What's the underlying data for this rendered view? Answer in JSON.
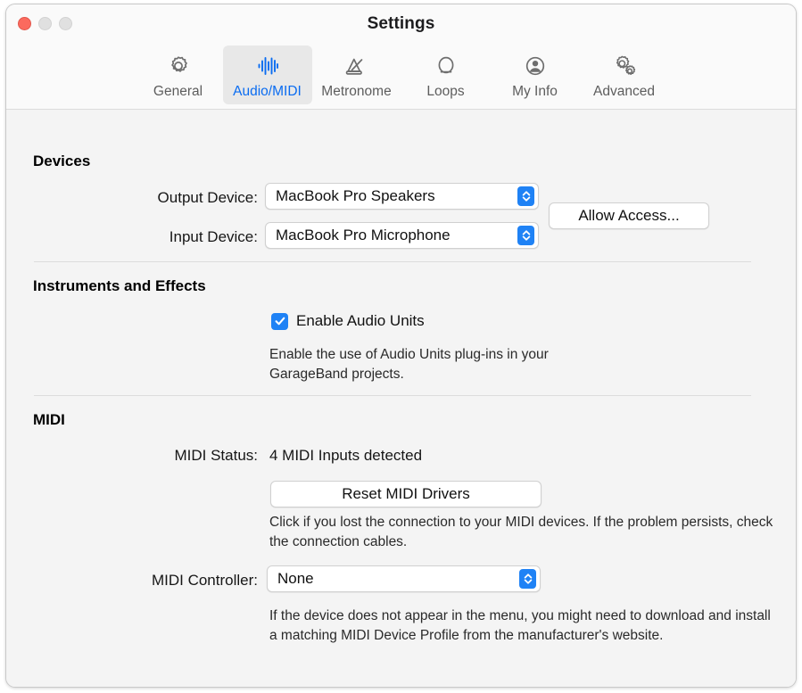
{
  "window": {
    "title": "Settings",
    "traffic_lights": [
      "close",
      "minimize",
      "maximize"
    ]
  },
  "toolbar": {
    "items": [
      {
        "label": "General",
        "icon": "gear-icon",
        "selected": false
      },
      {
        "label": "Audio/MIDI",
        "icon": "waveform-icon",
        "selected": true
      },
      {
        "label": "Metronome",
        "icon": "metronome-icon",
        "selected": false
      },
      {
        "label": "Loops",
        "icon": "loop-icon",
        "selected": false
      },
      {
        "label": "My Info",
        "icon": "person-icon",
        "selected": false
      },
      {
        "label": "Advanced",
        "icon": "gears-icon",
        "selected": false
      }
    ],
    "accent_color": "#0a6cf1",
    "selected_bg": "#e8e8e8"
  },
  "devices": {
    "heading": "Devices",
    "output_label": "Output Device:",
    "output_value": "MacBook Pro Speakers",
    "input_label": "Input Device:",
    "input_value": "MacBook Pro Microphone",
    "allow_access_label": "Allow Access..."
  },
  "instruments": {
    "heading": "Instruments and Effects",
    "checkbox_label": "Enable Audio Units",
    "checkbox_checked": true,
    "description": "Enable the use of Audio Units plug-ins in your GarageBand projects."
  },
  "midi": {
    "heading": "MIDI",
    "status_label": "MIDI Status:",
    "status_value": "4 MIDI Inputs detected",
    "reset_button_label": "Reset MIDI Drivers",
    "reset_description": "Click if you lost the connection to your MIDI devices. If the problem persists, check the connection cables.",
    "controller_label": "MIDI Controller:",
    "controller_value": "None",
    "controller_description": "If the device does not appear in the menu, you might need to download and install a matching MIDI Device Profile from the manufacturer's website."
  },
  "colors": {
    "accent": "#1f82f5",
    "window_bg": "#f4f4f4",
    "toolbar_bg": "#fafafa",
    "divider": "#dcdcdc",
    "close_button": "#fb6a5e"
  }
}
